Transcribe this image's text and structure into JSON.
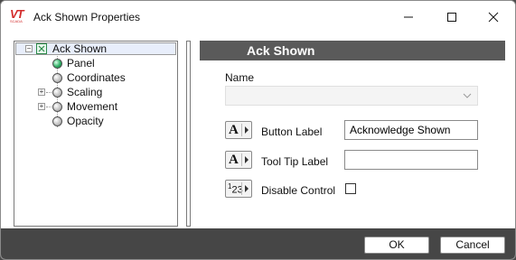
{
  "window": {
    "title": "Ack Shown Properties",
    "logo_text": "VT",
    "logo_sub": "SCADA"
  },
  "tree": {
    "items": [
      {
        "label": "Ack Shown",
        "icon": "checkbox-node-icon",
        "expander": "−"
      },
      {
        "label": "Panel",
        "icon": "green-ball-icon"
      },
      {
        "label": "Coordinates",
        "icon": "gray-ball-icon"
      },
      {
        "label": "Scaling",
        "icon": "gray-ball-icon",
        "expander": "+"
      },
      {
        "label": "Movement",
        "icon": "gray-ball-icon",
        "expander": "+"
      },
      {
        "label": "Opacity",
        "icon": "gray-ball-icon"
      }
    ]
  },
  "panel": {
    "header": "Ack Shown",
    "name_label": "Name",
    "name_value": "",
    "button_label": {
      "label": "Button Label",
      "value": "Acknowledge Shown",
      "icon_glyph": "A"
    },
    "tooltip_label": {
      "label": "Tool Tip Label",
      "value": "",
      "icon_glyph": "A"
    },
    "disable_control": {
      "label": "Disable Control",
      "checked": false,
      "icon_glyph_main": "2",
      "icon_glyph_sup": "1",
      "icon_glyph_end": "3"
    }
  },
  "footer": {
    "ok": "OK",
    "cancel": "Cancel"
  },
  "colors": {
    "header_bg": "#5a5a5a",
    "footer_bg": "#464646",
    "logo": "#d32b2b",
    "panel_ball": "#2fae64"
  }
}
